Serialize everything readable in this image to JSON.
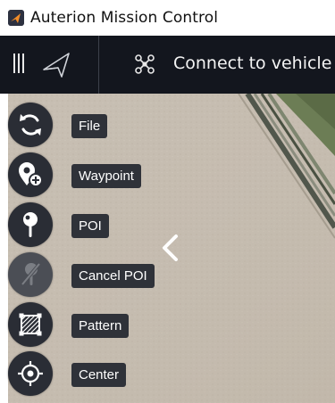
{
  "window": {
    "title": "Auterion Mission Control"
  },
  "toolbar": {
    "connect_label": "Connect to vehicle"
  },
  "plan_tools": [
    {
      "label": "File",
      "icon": "refresh-icon"
    },
    {
      "label": "Waypoint",
      "icon": "waypoint-add-icon"
    },
    {
      "label": "POI",
      "icon": "poi-pin-icon"
    },
    {
      "label": "Cancel POI",
      "icon": "cancel-poi-icon",
      "disabled": true
    },
    {
      "label": "Pattern",
      "icon": "pattern-icon"
    },
    {
      "label": "Center",
      "icon": "crosshair-icon"
    }
  ],
  "colors": {
    "toolbar": "#13161e",
    "button": "#2a2d35",
    "label": "#2f3239",
    "map": "#c9c0b4"
  }
}
